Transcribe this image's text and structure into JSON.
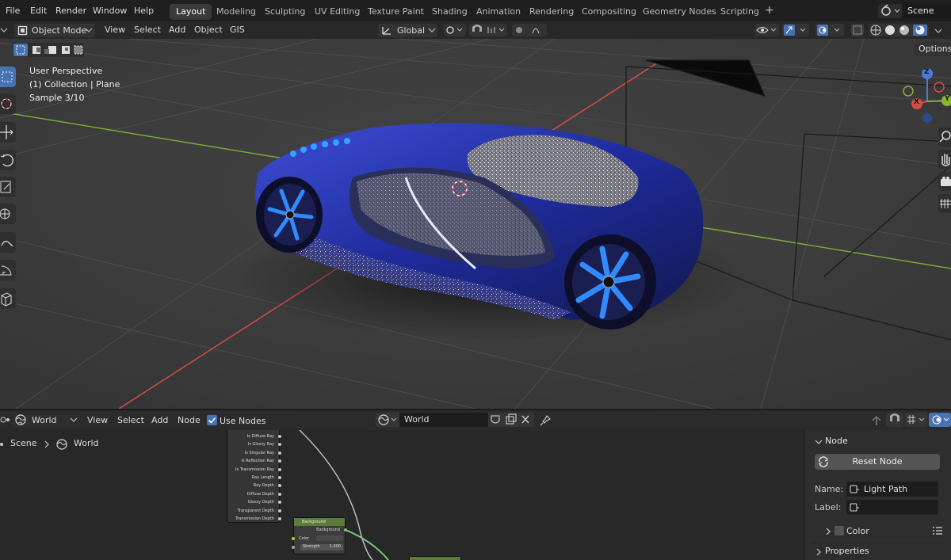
{
  "top_menu": {
    "items": [
      "File",
      "Edit",
      "Render",
      "Window",
      "Help"
    ],
    "workspaces": [
      "Layout",
      "Modeling",
      "Sculpting",
      "UV Editing",
      "Texture Paint",
      "Shading",
      "Animation",
      "Rendering",
      "Compositing",
      "Geometry Nodes",
      "Scripting"
    ],
    "active_workspace": "Layout",
    "add_tab": "+",
    "scene_name": "Scene"
  },
  "viewport_header": {
    "mode": "Object Mode",
    "menus": [
      "View",
      "Select",
      "Add",
      "Object",
      "GIS"
    ],
    "transform_orientation": "Global",
    "options_label": "Options"
  },
  "viewport_overlay": {
    "perspective": "User Perspective",
    "collection": "(1) Collection | Plane",
    "sample": "Sample 3/10"
  },
  "gizmo": {
    "z": "Z",
    "y": "Y",
    "x": "X"
  },
  "node_editor": {
    "world_type": "World",
    "menus": [
      "View",
      "Select",
      "Add",
      "Node"
    ],
    "use_nodes_label": "Use Nodes",
    "use_nodes_checked": true,
    "world_name": "World",
    "breadcrumb": [
      "Scene",
      "World"
    ],
    "light_path_outputs": [
      "Is Diffuse Ray",
      "Is Glossy Ray",
      "Is Singular Ray",
      "Is Reflection Ray",
      "Is Transmission Ray",
      "Ray Length",
      "Ray Depth",
      "Diffuse Depth",
      "Glossy Depth",
      "Transparent Depth",
      "Transmission Depth"
    ],
    "background_node": {
      "title": "Background",
      "output": "Background",
      "input_color": "Color",
      "input_strength": "Strength",
      "strength_value": "1.000"
    }
  },
  "n_panel": {
    "section": "Node",
    "reset_button": "Reset Node",
    "name_label": "Name:",
    "name_value": "Light Path",
    "label_label": "Label:",
    "label_value": "",
    "color_label": "Color",
    "properties_label": "Properties"
  },
  "colors": {
    "accent": "#4772b3",
    "node_green": "#5c7a3a",
    "axis_red": "#d84a4a",
    "axis_green": "#7aa83a",
    "car_blue": "#2a3aa8",
    "wheel_blue": "#2f8cff"
  }
}
